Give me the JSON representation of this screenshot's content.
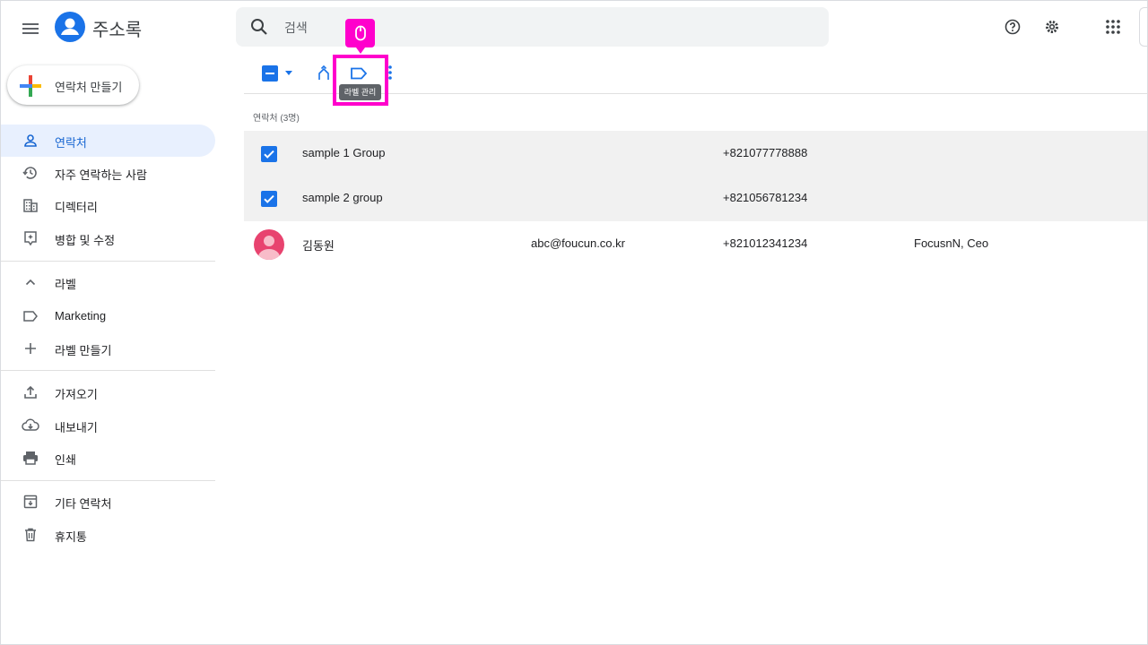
{
  "app": {
    "title": "주소록"
  },
  "search": {
    "placeholder": "검색"
  },
  "create_button": {
    "label": "연락처 만들기"
  },
  "sidebar": {
    "items": [
      {
        "label": "연락처",
        "icon": "person-icon",
        "active": true
      },
      {
        "label": "자주 연락하는 사람",
        "icon": "history-icon"
      },
      {
        "label": "디렉터리",
        "icon": "building-icon"
      },
      {
        "label": "병합 및 수정",
        "icon": "merge-fix-icon"
      }
    ],
    "labels_section": {
      "label": "라벨",
      "expanded": true
    },
    "labels": [
      {
        "label": "Marketing",
        "icon": "label-icon"
      },
      {
        "label": "라벨 만들기",
        "icon": "plus-icon"
      }
    ],
    "tools": [
      {
        "label": "가져오기",
        "icon": "upload-icon"
      },
      {
        "label": "내보내기",
        "icon": "cloud-download-icon"
      },
      {
        "label": "인쇄",
        "icon": "print-icon"
      }
    ],
    "other": [
      {
        "label": "기타 연락처",
        "icon": "archive-icon"
      },
      {
        "label": "휴지통",
        "icon": "trash-icon"
      }
    ]
  },
  "toolbar": {
    "tooltip": "라벨 관리"
  },
  "list": {
    "header": "연락처 (3명)",
    "rows": [
      {
        "name": "sample 1 Group",
        "email": "",
        "phone": "+821077778888",
        "job": "",
        "selected": true
      },
      {
        "name": "sample 2 group",
        "email": "",
        "phone": "+821056781234",
        "job": "",
        "selected": true
      },
      {
        "name": "김동원",
        "email": "abc@foucun.co.kr",
        "phone": "+821012341234",
        "job": "FocusnN, Ceo",
        "selected": false
      }
    ]
  },
  "colors": {
    "accent": "#1a73e8",
    "highlight": "#ff00cc",
    "selected_row": "#f1f1f1",
    "active_nav": "#e8f0fe"
  }
}
